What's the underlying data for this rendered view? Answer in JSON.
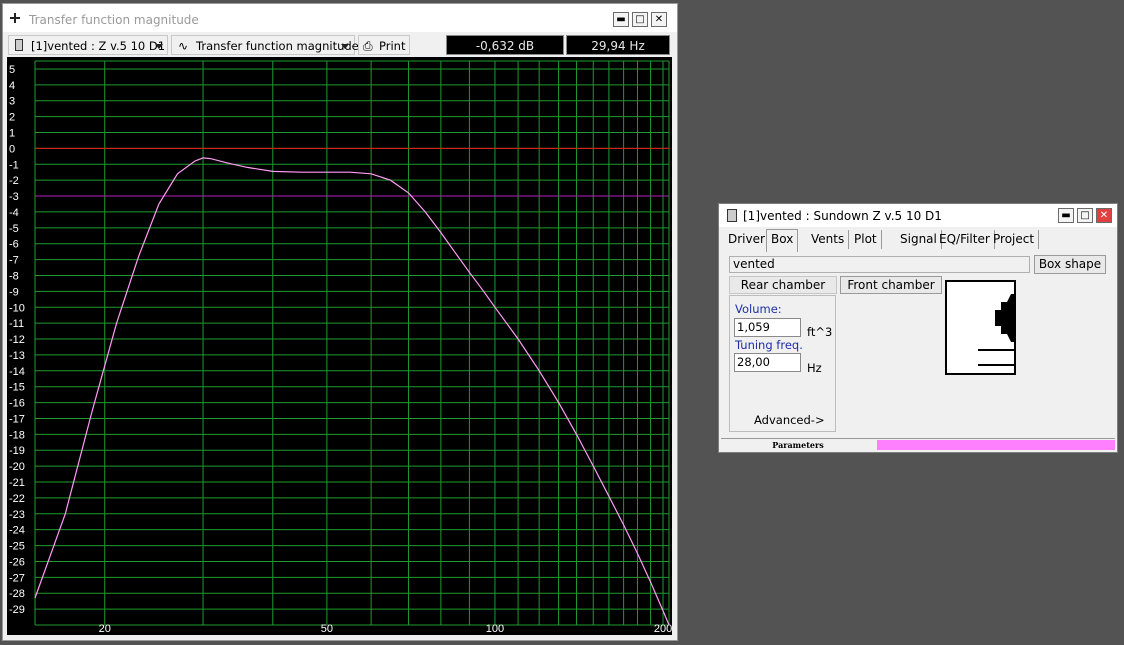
{
  "plot_window": {
    "title": "Transfer function magnitude",
    "toolbar": {
      "project_selector": "[1]vented : Z v.5 10 D1",
      "plot_type_selector": "Transfer function magnitude",
      "print_label": "Print"
    },
    "readouts": {
      "db": "-0,632 dB",
      "hz": "29,94 Hz"
    },
    "buttons": {
      "minimize": "▬",
      "maximize": "□",
      "close": "✕"
    }
  },
  "box_window": {
    "title": "[1]vented : Sundown Z v.5 10 D1",
    "tabs": [
      "Driver",
      "Box",
      "Vents",
      "Plot",
      "Signal",
      "EQ/Filter",
      "Project"
    ],
    "active_tab": "Box",
    "box_name": "vented",
    "box_shape_label": "Box shape",
    "rear_chamber_label": "Rear chamber",
    "front_chamber_label": "Front chamber",
    "volume_label": "Volume:",
    "volume_value": "1,059",
    "volume_unit": "ft^3",
    "tuning_label": "Tuning freq.",
    "tuning_value": "28,00",
    "tuning_unit": "Hz",
    "advanced_label": "Advanced->",
    "status_label": "Parameters",
    "buttons": {
      "minimize": "▬",
      "maximize": "□",
      "close": "✕"
    }
  },
  "colors": {
    "plot_bg": "#000000",
    "grid": "#1f9a2e",
    "curve": "#ff9cf5",
    "zero_line": "#e41b1b",
    "ref_line": "#b41fb4",
    "status_accent": "#ff80ff",
    "close_button": "#e04040"
  },
  "chart_data": {
    "type": "line",
    "x_scale": "log",
    "x_ticks": [
      20,
      50,
      100,
      200
    ],
    "xlim": [
      15,
      205
    ],
    "ylim": [
      -30,
      5.5
    ],
    "y_ticks": [
      5,
      4,
      3,
      2,
      1,
      0,
      -1,
      -2,
      -3,
      -4,
      -5,
      -6,
      -7,
      -8,
      -9,
      -10,
      -11,
      -12,
      -13,
      -14,
      -15,
      -16,
      -17,
      -18,
      -19,
      -20,
      -21,
      -22,
      -23,
      -24,
      -25,
      -26,
      -27,
      -28,
      -29
    ],
    "reference_lines": [
      0,
      -3
    ],
    "grid": true,
    "series": [
      {
        "x": [
          15,
          17,
          19,
          21,
          23,
          25,
          27,
          29,
          30,
          31,
          33,
          36,
          40,
          45,
          50,
          55,
          60,
          65,
          70,
          75,
          80,
          85,
          90,
          95,
          100,
          110,
          120,
          130,
          140,
          150,
          160,
          170,
          180,
          190,
          200,
          205
        ],
        "y": [
          -28.3,
          -23,
          -16.5,
          -11,
          -6.8,
          -3.5,
          -1.6,
          -0.8,
          -0.6,
          -0.65,
          -0.9,
          -1.2,
          -1.45,
          -1.5,
          -1.5,
          -1.5,
          -1.6,
          -2.0,
          -2.8,
          -4.0,
          -5.3,
          -6.6,
          -7.8,
          -8.9,
          -10.0,
          -12.0,
          -14.0,
          -16.0,
          -18.0,
          -20.0,
          -21.9,
          -23.7,
          -25.5,
          -27.3,
          -29.1,
          -30.0
        ]
      }
    ]
  }
}
